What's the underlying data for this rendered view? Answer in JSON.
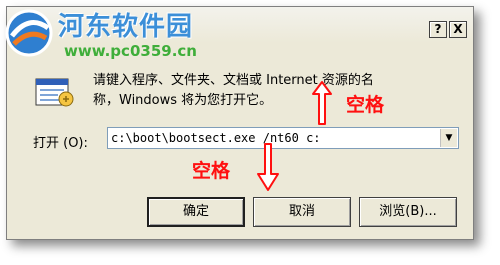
{
  "dialog": {
    "help_button": "?",
    "close_button": "X"
  },
  "watermark": {
    "title": "河东软件园",
    "url": "www.pc0359.cn"
  },
  "prompt": {
    "line1": "请键入程序、文件夹、文档或 Internet 资源的名",
    "line2": "称，Windows 将为您打开它。"
  },
  "open": {
    "label": "打开 (O):",
    "value": "c:\\boot\\bootsect.exe /nt60 c:"
  },
  "buttons": {
    "ok": "确定",
    "cancel": "取消",
    "browse": "浏览(B)..."
  },
  "annotations": {
    "top": "空格",
    "bottom": "空格"
  },
  "colors": {
    "annotation": "#ff1010",
    "watermark_title": "#3c8fd8",
    "watermark_url": "#3fae3a"
  },
  "icons": {
    "run": "run-program-icon",
    "logo": "site-logo-icon",
    "arrow": "red-arrow-icon"
  }
}
